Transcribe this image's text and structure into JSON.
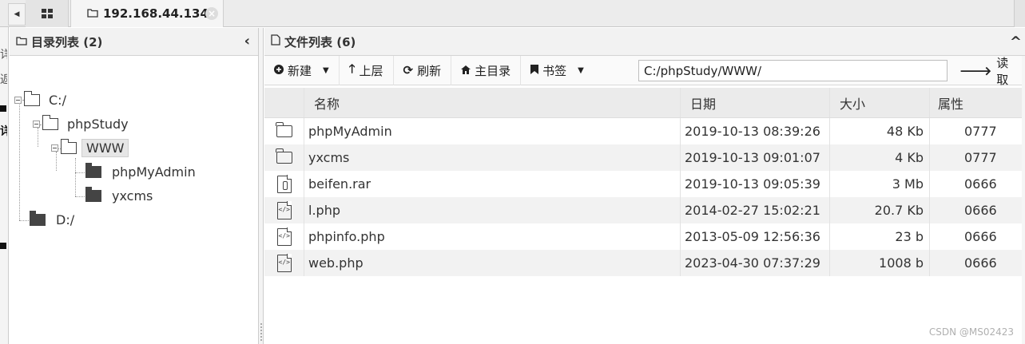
{
  "tabs": {
    "home_icon": "grid-icon",
    "active_tab_label": "192.168.44.134",
    "close_symbol": "×"
  },
  "left_edge_fragments": [
    "详",
    "返",
    "详"
  ],
  "dir_panel": {
    "title": "目录列表 (2)",
    "collapse_symbol": "‹",
    "tree": {
      "c_drive": "C:/",
      "phpstudy": "phpStudy",
      "www": "WWW",
      "phpmyadmin": "phpMyAdmin",
      "yxcms": "yxcms",
      "d_drive": "D:/"
    }
  },
  "file_panel": {
    "title": "文件列表 (6)",
    "expand_symbol": "^",
    "toolbar": {
      "new_label": "新建",
      "up_label": "上层",
      "refresh_label": "刷新",
      "home_label": "主目录",
      "bookmark_label": "书签",
      "path_value": "C:/phpStudy/WWW/",
      "read_label": "读取"
    },
    "columns": {
      "name": "名称",
      "date": "日期",
      "size": "大小",
      "attr": "属性"
    },
    "files": [
      {
        "icon": "folder-icon",
        "name": "phpMyAdmin",
        "date": "2019-10-13 08:39:26",
        "size": "48 Kb",
        "attr": "0777"
      },
      {
        "icon": "folder-icon",
        "name": "yxcms",
        "date": "2019-10-13 09:01:07",
        "size": "4 Kb",
        "attr": "0777"
      },
      {
        "icon": "archive-file-icon",
        "name": "beifen.rar",
        "date": "2019-10-13 09:05:39",
        "size": "3 Mb",
        "attr": "0666"
      },
      {
        "icon": "code-file-icon",
        "name": "l.php",
        "date": "2014-02-27 15:02:21",
        "size": "20.7 Kb",
        "attr": "0666"
      },
      {
        "icon": "code-file-icon",
        "name": "phpinfo.php",
        "date": "2013-05-09 12:56:36",
        "size": "23 b",
        "attr": "0666"
      },
      {
        "icon": "code-file-icon",
        "name": "web.php",
        "date": "2023-04-30 07:37:29",
        "size": "1008 b",
        "attr": "0666"
      }
    ]
  },
  "watermark": "CSDN @MS02423"
}
